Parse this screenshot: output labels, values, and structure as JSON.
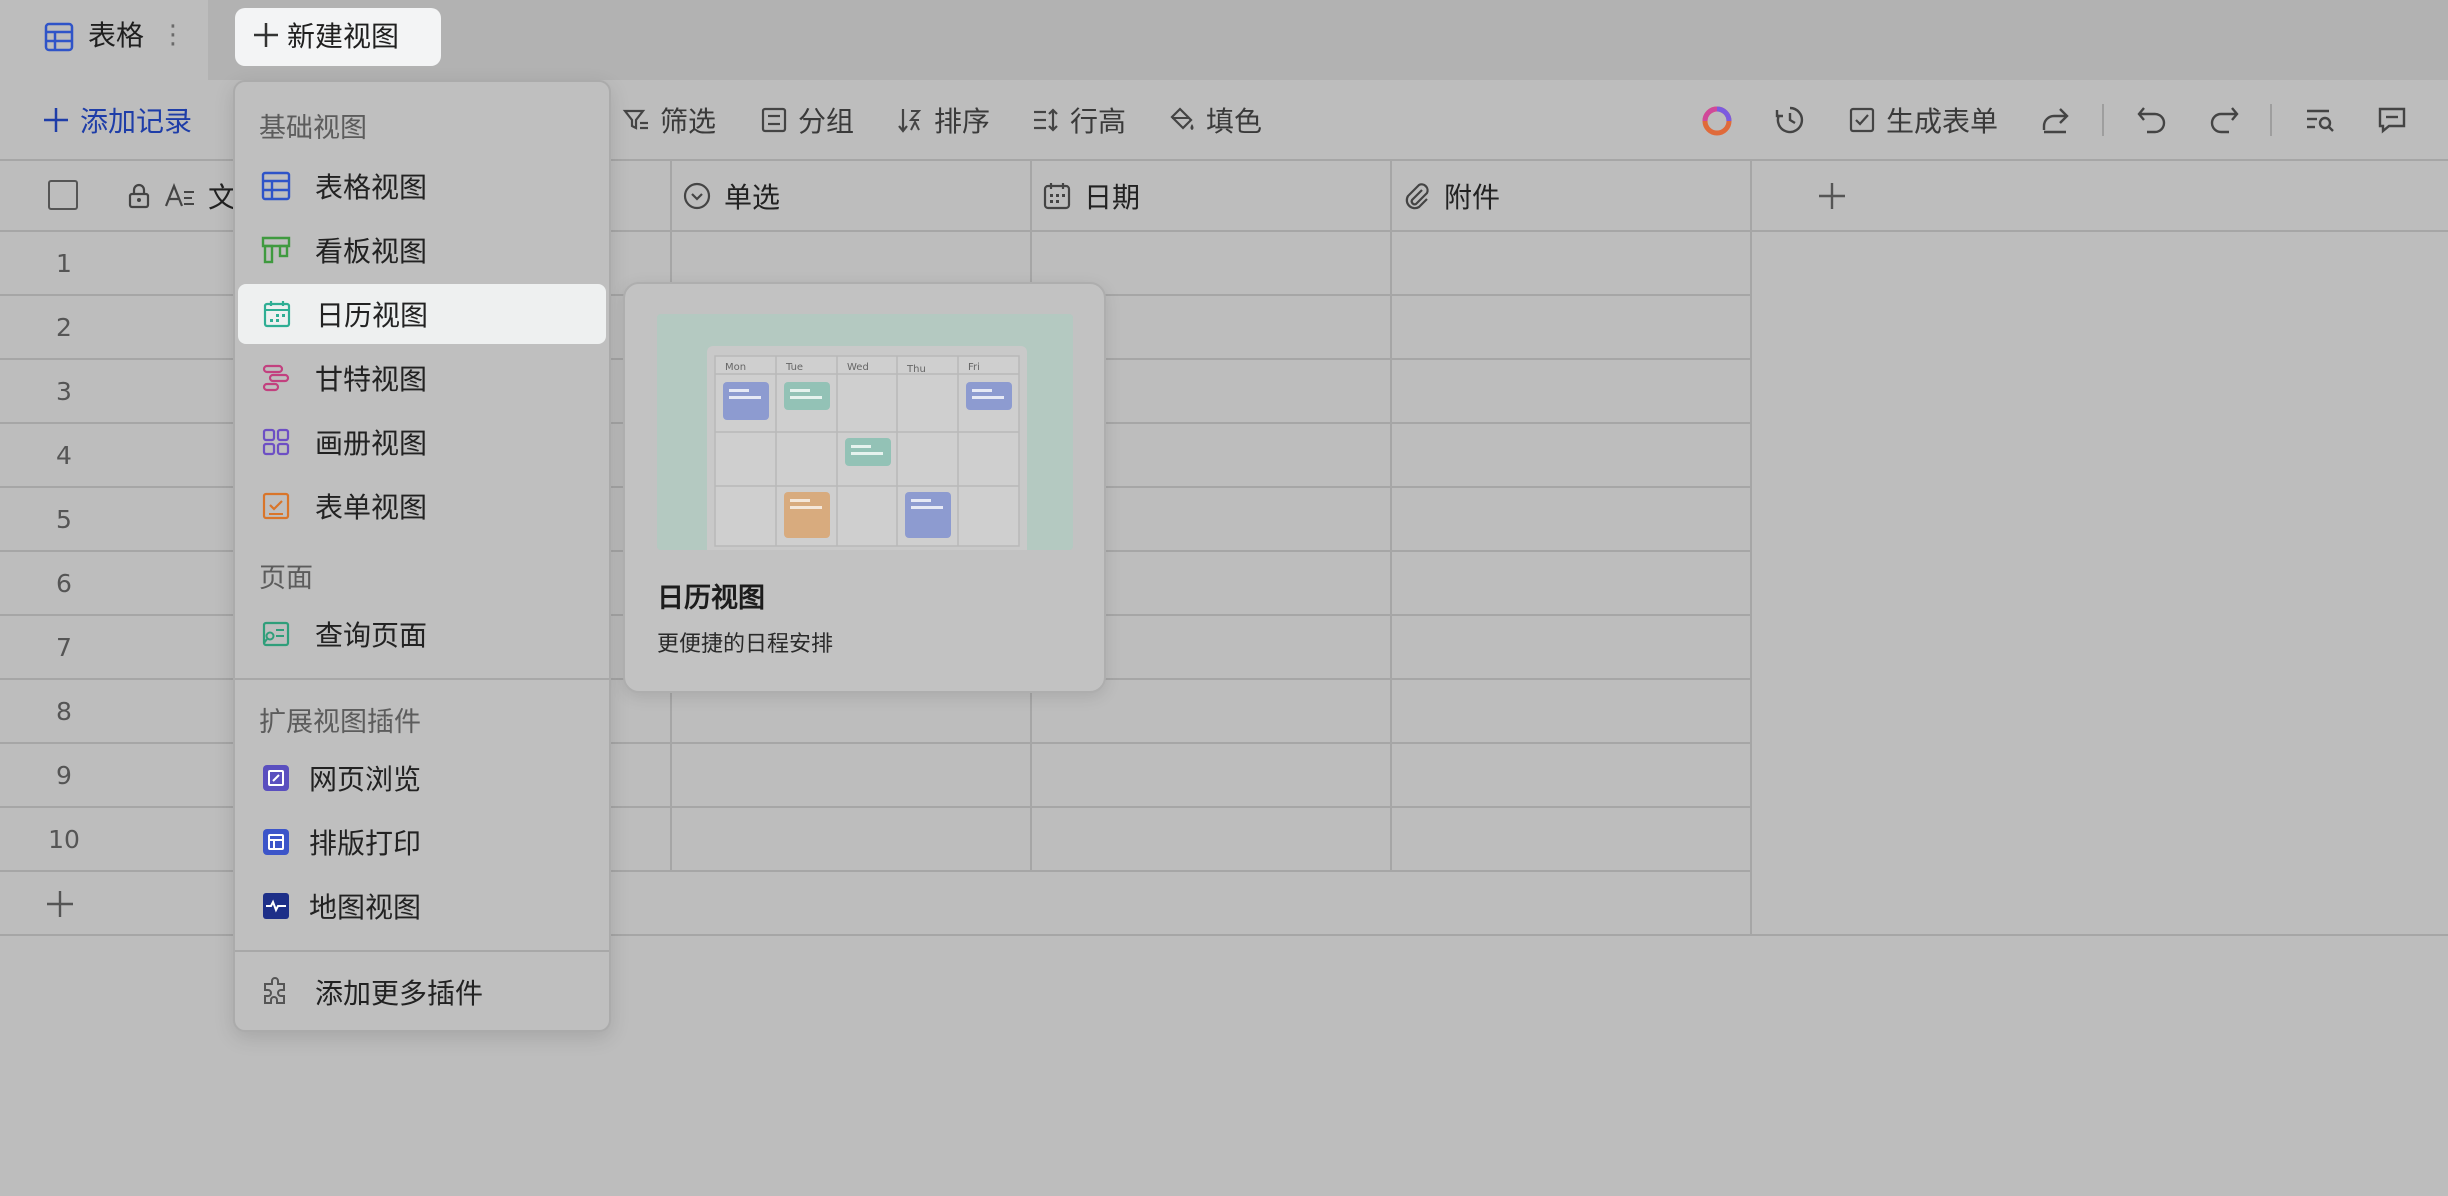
{
  "tab": {
    "label": "表格",
    "more": "⋮"
  },
  "new_view_button": {
    "label": "新建视图"
  },
  "toolbar": {
    "add_record": "添加记录",
    "filter": "筛选",
    "group": "分组",
    "sort": "排序",
    "row_height": "行高",
    "fill_color": "填色",
    "generate_form": "生成表单"
  },
  "columns": [
    {
      "label": "文",
      "icon": "text-icon"
    },
    {
      "label": "单选",
      "icon": "single-select-icon"
    },
    {
      "label": "日期",
      "icon": "calendar-icon"
    },
    {
      "label": "附件",
      "icon": "attachment-icon"
    }
  ],
  "rows": [
    "1",
    "2",
    "3",
    "4",
    "5",
    "6",
    "7",
    "8",
    "9",
    "10"
  ],
  "menu": {
    "section_basic": "基础视图",
    "basic_items": [
      {
        "label": "表格视图",
        "icon": "grid-view-icon",
        "color": "#2f54c8"
      },
      {
        "label": "看板视图",
        "icon": "kanban-view-icon",
        "color": "#3f9a3f"
      },
      {
        "label": "日历视图",
        "icon": "calendar-view-icon",
        "color": "#2fae94"
      },
      {
        "label": "甘特视图",
        "icon": "gantt-view-icon",
        "color": "#c2417f"
      },
      {
        "label": "画册视图",
        "icon": "gallery-view-icon",
        "color": "#6d4fc4"
      },
      {
        "label": "表单视图",
        "icon": "form-view-icon",
        "color": "#d9752a"
      }
    ],
    "section_page": "页面",
    "page_items": [
      {
        "label": "查询页面",
        "icon": "query-page-icon",
        "color": "#2f9e7a"
      }
    ],
    "section_ext": "扩展视图插件",
    "ext_items": [
      {
        "label": "网页浏览",
        "icon": "web-browse-icon",
        "color": "#5a4fbf"
      },
      {
        "label": "排版打印",
        "icon": "layout-print-icon",
        "color": "#3c55c9"
      },
      {
        "label": "地图视图",
        "icon": "map-view-icon",
        "color": "#1d2f88"
      }
    ],
    "add_more": {
      "label": "添加更多插件",
      "icon": "puzzle-icon"
    }
  },
  "preview": {
    "title": "日历视图",
    "desc": "更便捷的日程安排",
    "days": [
      "Mon",
      "Tue",
      "Wed",
      "Thu",
      "Fri"
    ]
  }
}
